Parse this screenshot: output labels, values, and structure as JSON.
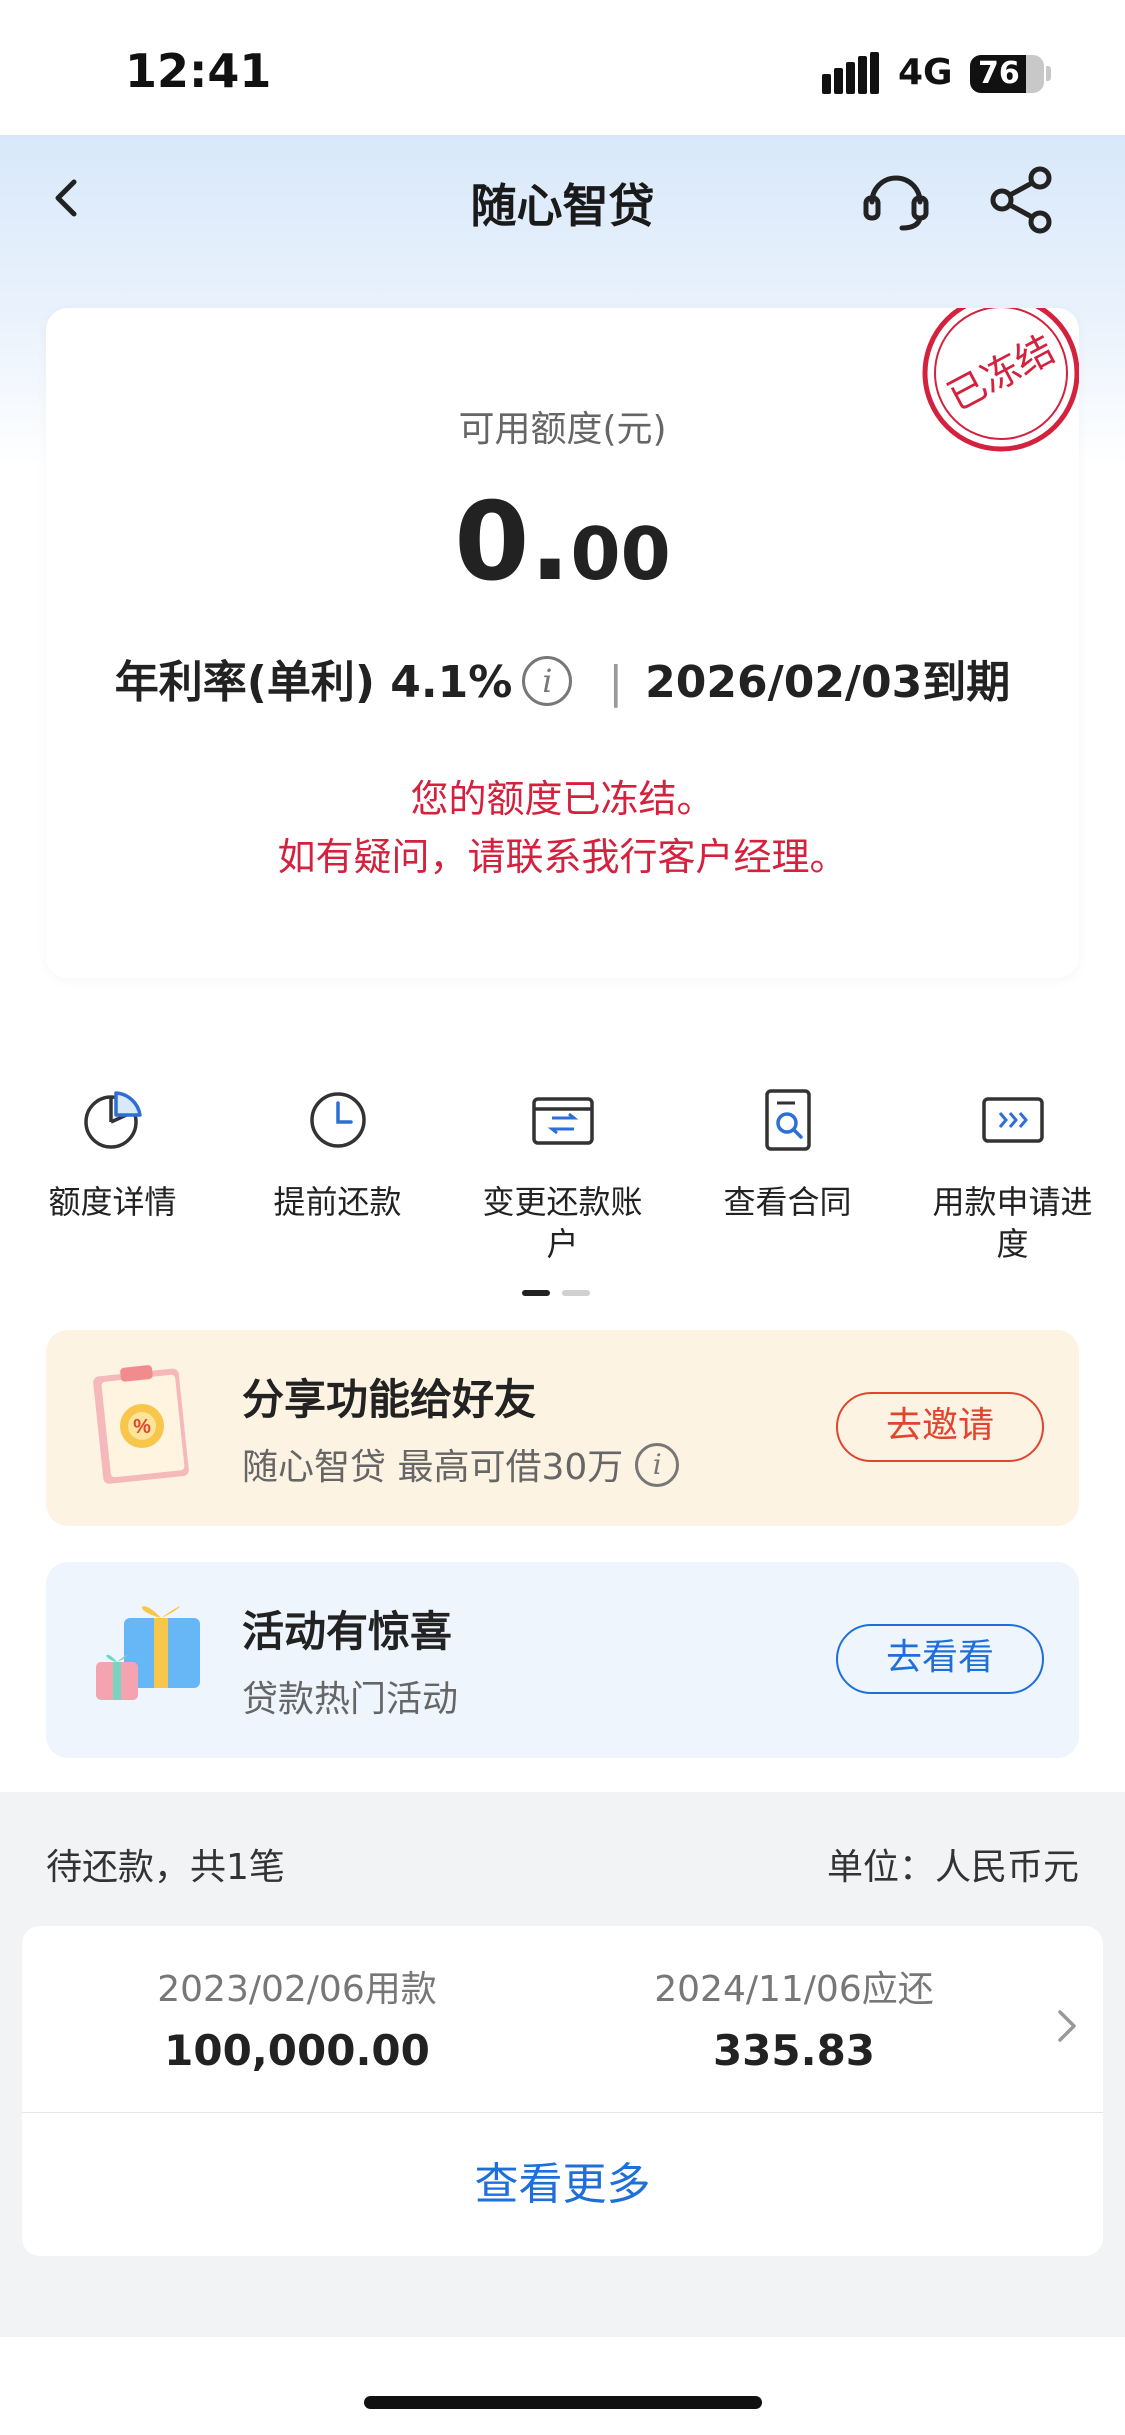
{
  "status_bar": {
    "time": "12:41",
    "network": "4G",
    "battery": "76",
    "battery_level": 0.76
  },
  "nav": {
    "title": "随心智贷",
    "back_icon": "chevron-left-icon",
    "service_icon": "headset-icon",
    "share_icon": "share-icon"
  },
  "credit_card": {
    "stamp": "已冻结",
    "label": "可用额度(元)",
    "amount_int": "0.",
    "amount_dec": "00",
    "rate_text": "年利率(单利) 4.1%",
    "info_glyph": "i",
    "separator": "|",
    "due_text": "2026/02/03到期",
    "notice_line1": "您的额度已冻结。",
    "notice_line2": "如有疑问，请联系我行客户经理。"
  },
  "actions": [
    {
      "label": "额度详情",
      "icon": "pie-chart-icon"
    },
    {
      "label": "提前还款",
      "icon": "clock-icon"
    },
    {
      "label": "变更还款账户",
      "icon": "card-exchange-icon"
    },
    {
      "label": "查看合同",
      "icon": "document-search-icon"
    },
    {
      "label": "用款申请进度",
      "icon": "progress-arrows-icon"
    }
  ],
  "promo_share": {
    "title": "分享功能给好友",
    "subtitle": "随心智贷 最高可借30万",
    "button": "去邀请"
  },
  "promo_activity": {
    "title": "活动有惊喜",
    "subtitle": "贷款热门活动",
    "button": "去看看"
  },
  "repayment": {
    "header_left": "待还款，共1笔",
    "header_right": "单位：人民币元",
    "loan_date_label": "2023/02/06用款",
    "loan_amount": "100,000.00",
    "due_date_label": "2024/11/06应还",
    "due_amount": "335.83",
    "view_more": "查看更多"
  },
  "colors": {
    "accent_red": "#d4213d",
    "link_blue": "#1f6fd8",
    "share_bg": "#fdf3e3",
    "activity_bg": "#eef5fd"
  }
}
